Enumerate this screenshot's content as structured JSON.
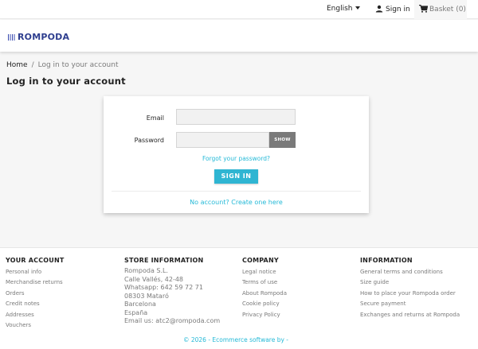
{
  "topnav": {
    "language": "English",
    "sign_in": "Sign in",
    "basket": "Basket (0)"
  },
  "header": {
    "logo_text": "ROMPODA"
  },
  "breadcrumb": {
    "home": "Home",
    "separator": "/",
    "current": "Log in to your account"
  },
  "page_title": "Log in to your account",
  "login_form": {
    "email_label": "Email",
    "email_value": "",
    "password_label": "Password",
    "password_value": "",
    "show_button": "SHOW",
    "forgot_link": "Forgot your password?",
    "submit_button": "SIGN IN",
    "create_account_link": "No account? Create one here"
  },
  "footer": {
    "columns": [
      {
        "title": "YOUR ACCOUNT",
        "items": [
          "Personal info",
          "Merchandise returns",
          "Orders",
          "Credit notes",
          "Addresses",
          "Vouchers"
        ]
      },
      {
        "title": "STORE INFORMATION",
        "items": [
          "Rompoda S.L.",
          "Calle Vallés, 42-48",
          "Whatsapp: 642 59 72 71",
          "08303 Mataró",
          "Barcelona",
          "España",
          "Email us: atc2@rompoda.com"
        ]
      },
      {
        "title": "COMPANY",
        "items": [
          "Legal notice",
          "Terms of use",
          "About Rompoda",
          "Cookie policy",
          "Privacy Policy"
        ]
      },
      {
        "title": "INFORMATION",
        "items": [
          "General terms and conditions",
          "Size guide",
          "How to place your Rompoda order",
          "Secure payment",
          "Exchanges and returns at Rompoda"
        ]
      }
    ],
    "copyright": "© 2026 - Ecommerce software by -"
  },
  "colors": {
    "accent": "#2fb5d2",
    "link": "#24b9d7",
    "logo": "#2e3e8f",
    "show_button_bg": "#7a7a7a"
  }
}
